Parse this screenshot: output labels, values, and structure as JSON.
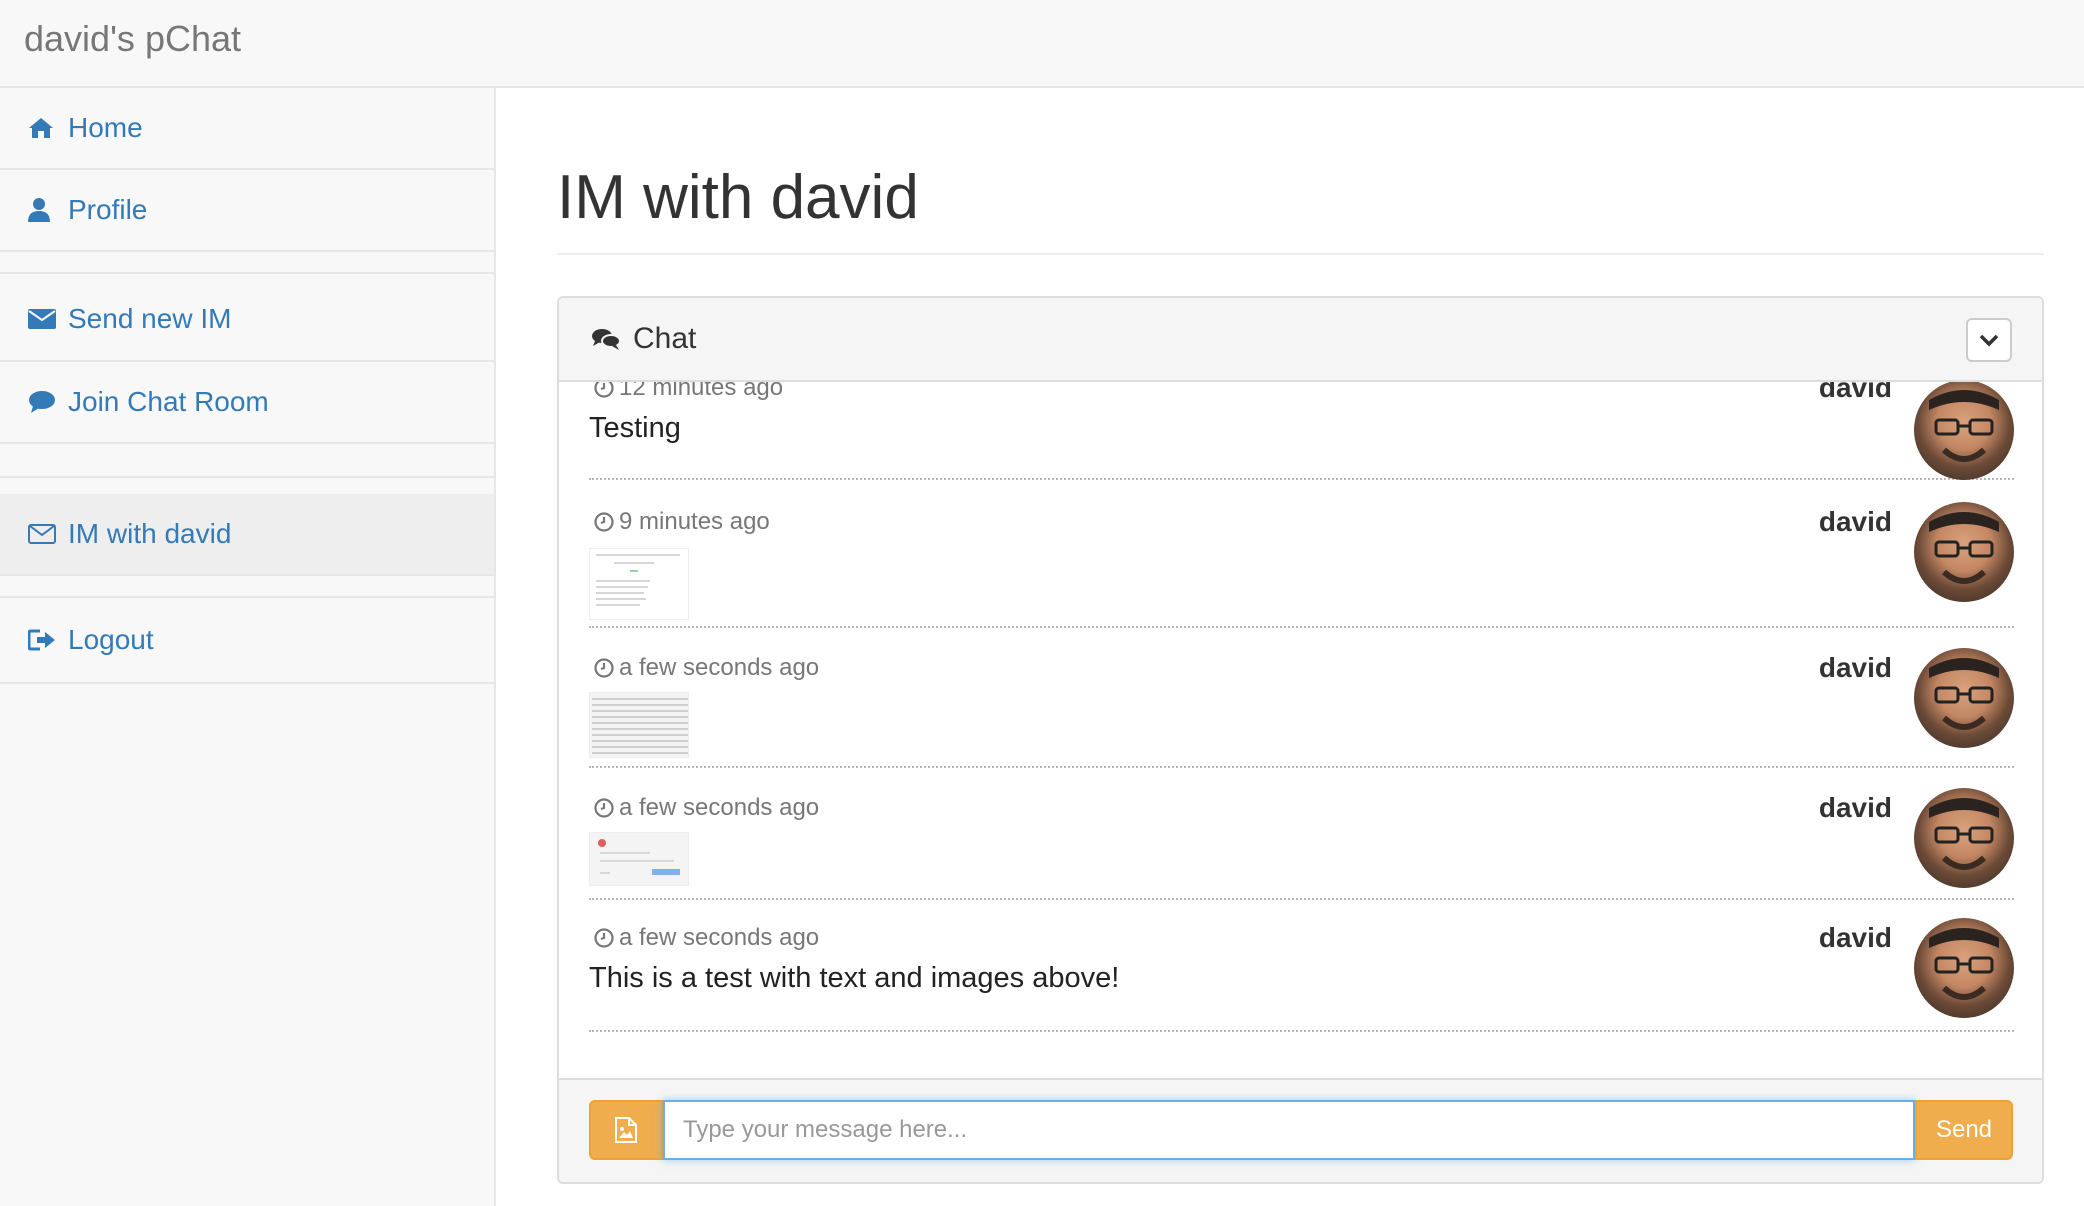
{
  "navbar": {
    "brand": "david's pChat"
  },
  "sidebar": {
    "items": [
      {
        "label": "Home",
        "icon": "home-icon"
      },
      {
        "label": "Profile",
        "icon": "user-icon"
      },
      {
        "label": "Send new IM",
        "icon": "envelope-icon"
      },
      {
        "label": "Join Chat Room",
        "icon": "comment-icon"
      },
      {
        "label": "IM with david",
        "icon": "envelope-outline-icon",
        "active": true
      },
      {
        "label": "Logout",
        "icon": "logout-icon"
      }
    ]
  },
  "main": {
    "title": "IM with david",
    "panel": {
      "heading": "Chat",
      "messages": [
        {
          "time": "12 minutes ago",
          "author": "david",
          "text": "Testing"
        },
        {
          "time": "9 minutes ago",
          "author": "david",
          "attachment": "image-thumbnail"
        },
        {
          "time": "a few seconds ago",
          "author": "david",
          "attachment": "image-thumbnail"
        },
        {
          "time": "a few seconds ago",
          "author": "david",
          "attachment": "image-thumbnail"
        },
        {
          "time": "a few seconds ago",
          "author": "david",
          "text": "This is a test with text and images above!"
        }
      ],
      "input_placeholder": "Type your message here...",
      "send_label": "Send"
    }
  },
  "colors": {
    "link": "#337ab7",
    "warning": "#f0ad4e",
    "focus": "#66afe9"
  }
}
